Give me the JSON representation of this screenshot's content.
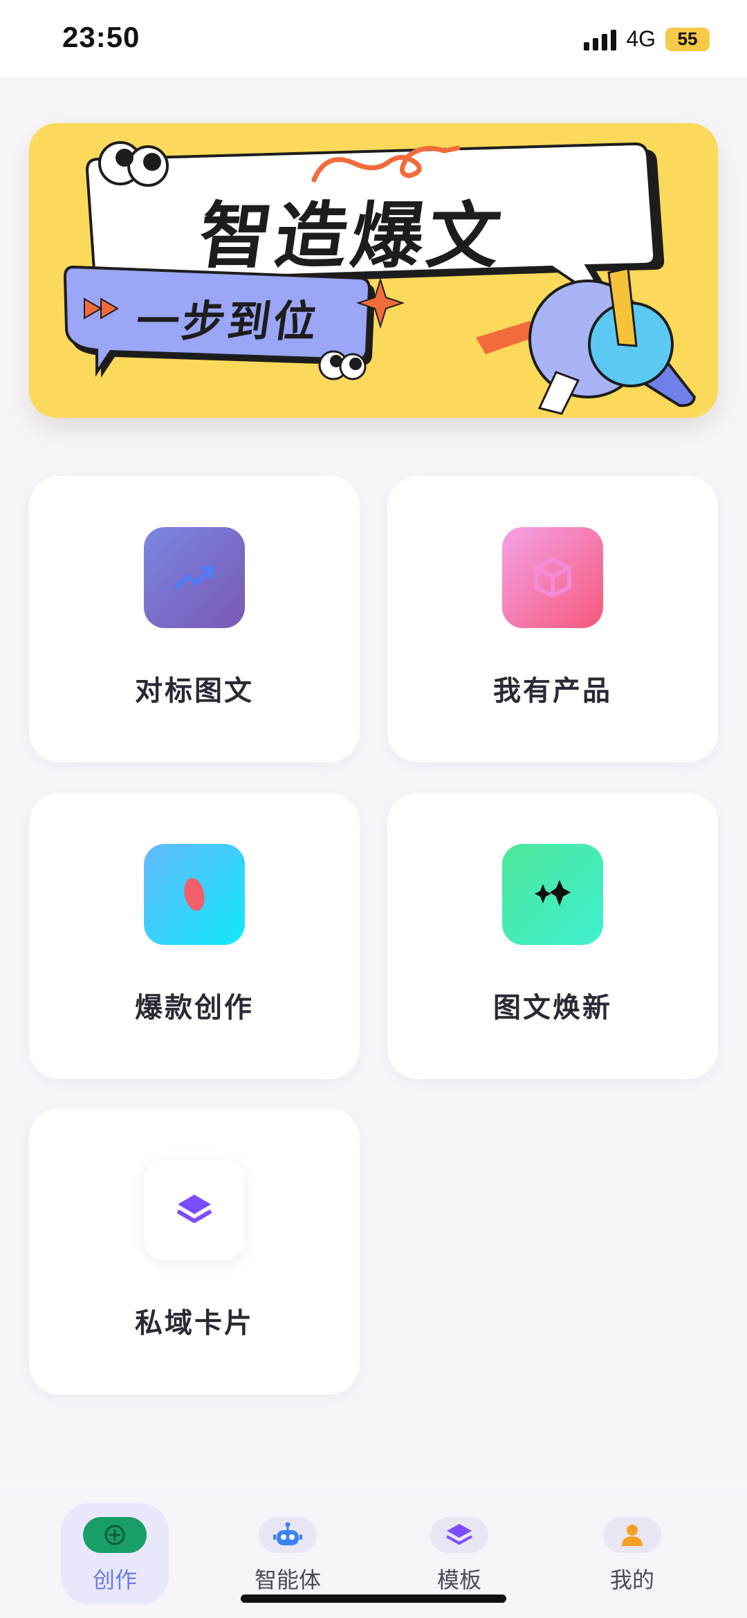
{
  "status_bar": {
    "time": "23:50",
    "network": "4G",
    "battery": "55"
  },
  "banner": {
    "title": "智造爆文",
    "subtitle": "一步到位"
  },
  "cards": [
    {
      "label": "对标图文",
      "icon": "trending-up-icon"
    },
    {
      "label": "我有产品",
      "icon": "package-box-icon"
    },
    {
      "label": "爆款创作",
      "icon": "pill-icon"
    },
    {
      "label": "图文焕新",
      "icon": "sparkles-icon"
    },
    {
      "label": "私域卡片",
      "icon": "layers-icon"
    }
  ],
  "bottom_nav": {
    "items": [
      {
        "label": "创作",
        "icon": "plus-icon",
        "active": true,
        "color": "#1a9e67"
      },
      {
        "label": "智能体",
        "icon": "robot-icon",
        "active": false,
        "color": "#3b82f6"
      },
      {
        "label": "模板",
        "icon": "layers-icon",
        "active": false,
        "color": "#7c4dff"
      },
      {
        "label": "我的",
        "icon": "user-icon",
        "active": false,
        "color": "#f5a020"
      }
    ]
  },
  "colors": {
    "accent": "#1a9e67",
    "banner_bg": "#fbd95a",
    "page_bg": "#f8f5fa"
  }
}
